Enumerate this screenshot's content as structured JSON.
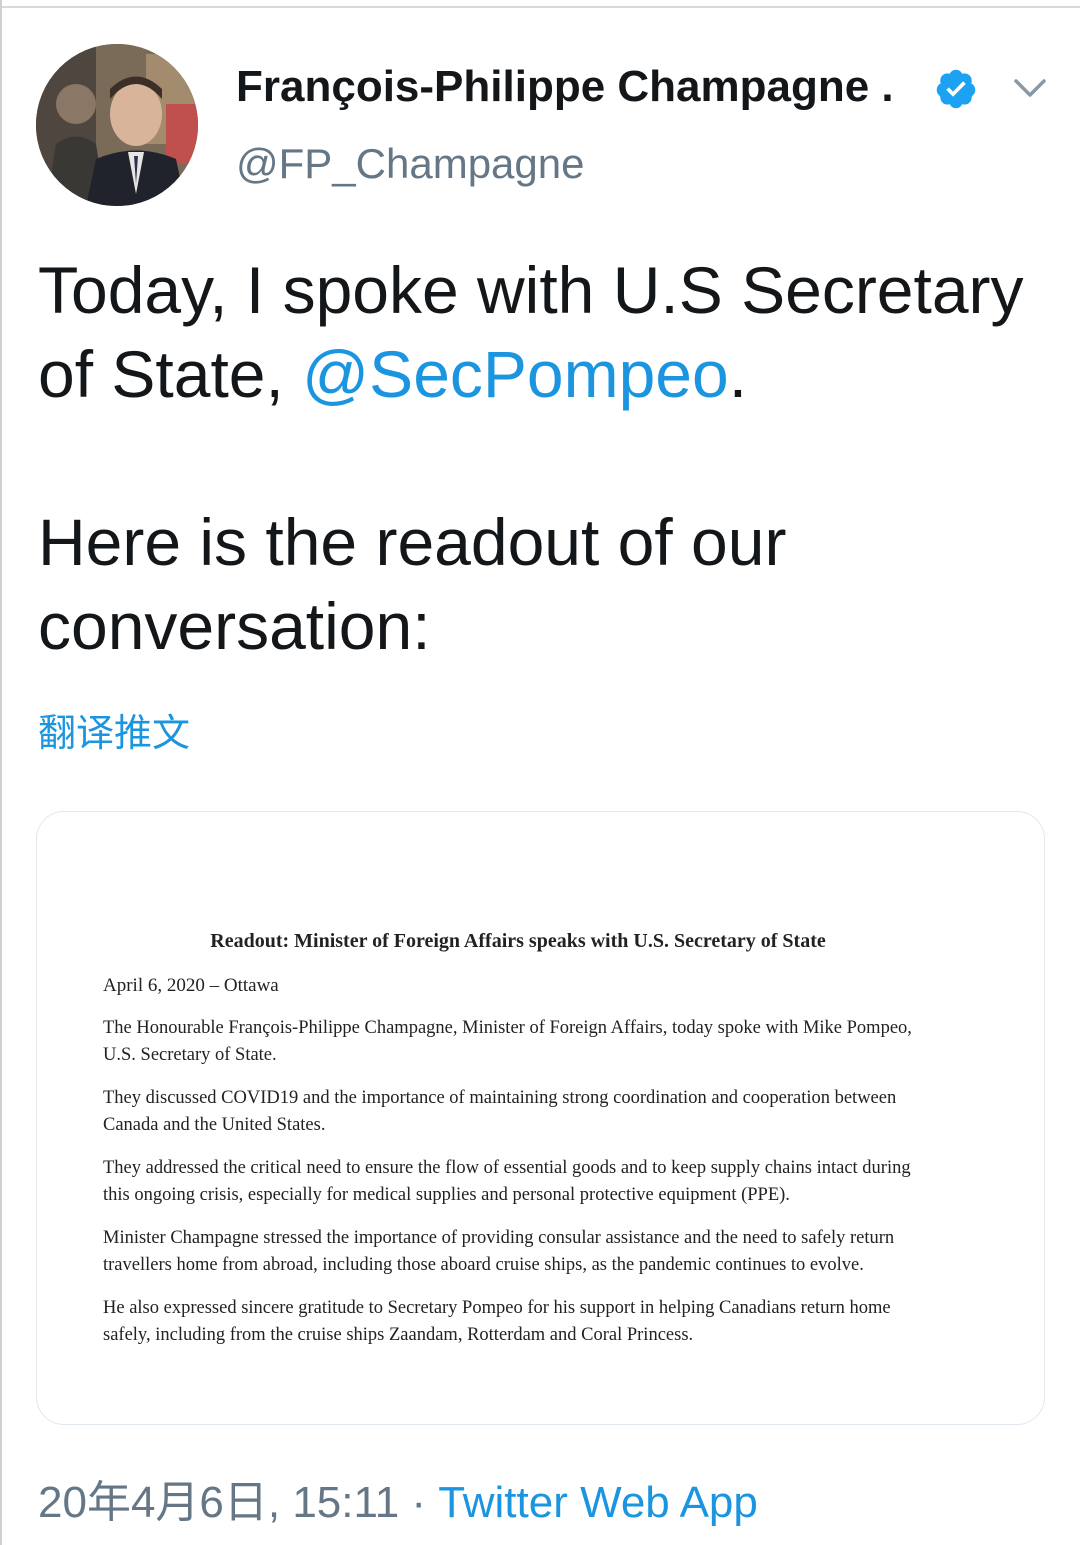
{
  "author": {
    "display_name": "François-Philippe Champagne ...",
    "handle": "@FP_Champagne",
    "verified_icon": "verified-badge-icon",
    "menu_icon": "chevron-down-icon"
  },
  "tweet": {
    "line1_prefix": "Today, I spoke with U.S Secretary of State, ",
    "mention": "@SecPompeo",
    "line1_suffix": ".",
    "paragraph2": "Here is the readout of our conversation:",
    "translate_label": "翻译推文"
  },
  "document": {
    "title": "Readout: Minister of Foreign Affairs speaks with U.S. Secretary of State",
    "dateline": "April 6, 2020 – Ottawa",
    "paragraphs": [
      "The Honourable François-Philippe Champagne, Minister of Foreign Affairs, today spoke with Mike Pompeo, U.S. Secretary of State.",
      "They discussed COVID19 and the importance of maintaining strong coordination and cooperation between Canada and the United States.",
      "They addressed the critical need to ensure the flow of essential goods and to keep supply chains intact during this ongoing crisis, especially for medical supplies and personal protective equipment (PPE).",
      "Minister Champagne stressed the importance of providing consular assistance and the need to safely return travellers home from abroad, including those aboard cruise ships, as the pandemic continues to evolve.",
      "He also expressed sincere gratitude to Secretary Pompeo for his support in helping Canadians return home safely, including from the cruise ships Zaandam, Rotterdam and Coral Princess."
    ]
  },
  "meta": {
    "timestamp": "20年4月6日, 15:11",
    "separator": " · ",
    "source": "Twitter Web App"
  },
  "colors": {
    "link": "#1b95e0",
    "secondary_text": "#657786",
    "primary_text": "#14171a"
  }
}
